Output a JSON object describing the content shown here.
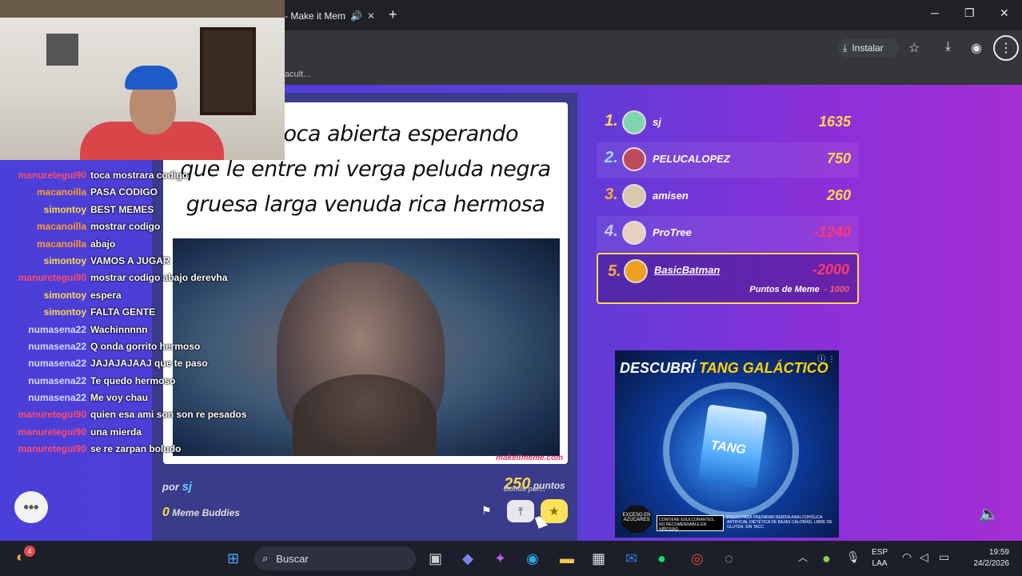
{
  "browser": {
    "tab_title": "- Make it Mem",
    "tab_audio_icon": "speaker-icon",
    "new_tab": "+",
    "minimize": "─",
    "maximize": "❐",
    "close": "✕",
    "install_label": "Instalar",
    "bookmark_text": "acult..."
  },
  "meme": {
    "caption_line1": "on la boca abierta esperando",
    "caption_line2": "que le entre mi verga peluda negra",
    "caption_line3": "gruesa larga venuda rica hermosa",
    "watermark": "makeitmeme.com",
    "author_prefix": "por",
    "author": "sj",
    "buddies_count": "0",
    "buddies_label": "Meme Buddies",
    "points_value": "250",
    "points_label": "puntos",
    "points_caption": "Bonus por..."
  },
  "chat": [
    {
      "user": "manuretegui90",
      "msg": "toca mostrara codigo",
      "color": "#ff4a6a"
    },
    {
      "user": "macanoilla",
      "msg": "PASA CODIGO",
      "color": "#ff9a2a"
    },
    {
      "user": "simontoy",
      "msg": "BEST MEMES",
      "color": "#ffd84a"
    },
    {
      "user": "macanoilla",
      "msg": "mostrar codigo",
      "color": "#ff9a2a"
    },
    {
      "user": "macanoilla",
      "msg": "abajo",
      "color": "#ff9a2a"
    },
    {
      "user": "simontoy",
      "msg": "VAMOS A JUGAR",
      "color": "#ffd84a"
    },
    {
      "user": "manuretegui90",
      "msg": "mostrar codigo abajo derevha",
      "color": "#ff4a6a"
    },
    {
      "user": "simontoy",
      "msg": "espera",
      "color": "#ffd84a"
    },
    {
      "user": "simontoy",
      "msg": "FALTA GENTE",
      "color": "#ffd84a"
    },
    {
      "user": "numasena22",
      "msg": "Wachinnnnn",
      "color": "#d6d9ff"
    },
    {
      "user": "numasena22",
      "msg": "Q onda gorrito hermoso",
      "color": "#d6d9ff"
    },
    {
      "user": "numasena22",
      "msg": "JAJAJAJAAJ que te paso",
      "color": "#d6d9ff"
    },
    {
      "user": "numasena22",
      "msg": "Te quedo hermoso",
      "color": "#d6d9ff"
    },
    {
      "user": "numasena22",
      "msg": "Me voy chau",
      "color": "#d6d9ff"
    },
    {
      "user": "manuretegui90",
      "msg": "quien esa ami son son re pesados",
      "color": "#ff4a6a"
    },
    {
      "user": "manuretegui90",
      "msg": "una mierda",
      "color": "#ff4a6a"
    },
    {
      "user": "manuretegui90",
      "msg": "se re zarpan boludo",
      "color": "#ff4a6a"
    }
  ],
  "leaderboard": [
    {
      "rank": "1.",
      "name": "sj",
      "score": "1635",
      "rank_color": "#ffd84a",
      "score_color": "#ffd84a",
      "avatar_color": "#7fd4b0"
    },
    {
      "rank": "2.",
      "name": "PELUCALOPEZ",
      "score": "750",
      "rank_color": "#9ad8ff",
      "score_color": "#ffd84a",
      "avatar_color": "#c04a5a"
    },
    {
      "rank": "3.",
      "name": "amisen",
      "score": "260",
      "rank_color": "#ffa53a",
      "score_color": "#ffd84a",
      "avatar_color": "#d8c8b0"
    },
    {
      "rank": "4.",
      "name": "ProTree",
      "score": "-1240",
      "rank_color": "#c8c8e8",
      "score_color": "#ff3a6a",
      "avatar_color": "#e8d0c0"
    }
  ],
  "me": {
    "rank": "5.",
    "name": "BasicBatman",
    "score": "-2000",
    "meme_points_label": "Puntos de Meme",
    "meme_points_value": "- 1000",
    "avatar_color": "#f0a020"
  },
  "ad": {
    "title_white": "DESCUBRÍ",
    "title_yellow": "TANG GALÁCTICO",
    "pack_label": "TANG",
    "badge": "EXCESO EN AZÚCARES",
    "legal": "CONTIENE EDULCORANTES, NO RECOMENDABLE EN NIÑOS/AS",
    "small": "POLVO PARA PREPARAR BEBIDA ANALCOHÓLICA ARTIFICIAL DIETÉTICA DE BAJAS CALORÍAS. LIBRE DE GLUTEN. SIN TACC"
  },
  "taskbar": {
    "search_placeholder": "Buscar",
    "notif_count": "4",
    "lang_top": "ESP",
    "lang_bottom": "LAA",
    "time": "19:59",
    "date": "24/2/2026"
  }
}
